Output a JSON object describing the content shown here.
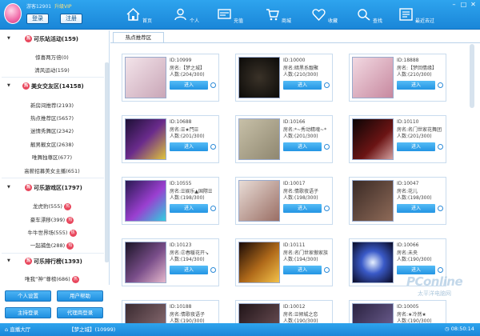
{
  "header": {
    "guest_text": "游客12901",
    "vip_text": "升级VIP",
    "login": "登录",
    "register": "注册",
    "nav": [
      {
        "label": "首页",
        "icon": "home-icon"
      },
      {
        "label": "个人",
        "icon": "user-icon"
      },
      {
        "label": "充值",
        "icon": "card-icon"
      },
      {
        "label": "商城",
        "icon": "cart-icon"
      },
      {
        "label": "收藏",
        "icon": "heart-icon"
      },
      {
        "label": "查找",
        "icon": "search-icon"
      },
      {
        "label": "最近去过",
        "icon": "history-icon"
      }
    ],
    "window_controls": {
      "min": "–",
      "max": "□",
      "close": "✕"
    }
  },
  "sidebar": {
    "categories": [
      {
        "title": "可乐站活动(159)",
        "items": [
          "惊喜两万倍(0)",
          "清风运动(159)"
        ]
      },
      {
        "title": "美女交友区(14158)",
        "items": [
          "新房间推荐(2193)",
          "热点推荐区(5657)",
          "迷情秀舞区(2342)",
          "靓男靓女区(2638)",
          "唯舞独尊区(677)",
          "高薪招募美女主播(651)"
        ]
      },
      {
        "title": "可乐游戏区(1797)",
        "items": [
          "龙虎豹(555)",
          "豪车漂移(399)",
          "牛牛世界场(555)",
          "一起捕鱼(288)"
        ]
      },
      {
        "title": "可乐排行榜(1393)",
        "items": [
          "唯我“神”尊榜(686)"
        ]
      }
    ],
    "hot_badge": "热",
    "cat_badge": "热",
    "buttons": [
      "个人设置",
      "用户帮助",
      "主持登录",
      "代理商登录"
    ]
  },
  "main": {
    "tab": "热点推荐区",
    "enter_label": "进入",
    "cards": [
      {
        "id": "ID:10999",
        "name": "房名:【梦之城】",
        "count": "人数:(204/300)"
      },
      {
        "id": "ID:10000",
        "name": "房名:暗黑系靓聚",
        "count": "人数:(210/300)"
      },
      {
        "id": "ID:18888",
        "name": "房名:【梦回情缘】",
        "count": "人数:(210/300)"
      },
      {
        "id": "ID:10688",
        "name": "房名:☰★門☰",
        "count": "人数:(201/300)"
      },
      {
        "id": "ID:10166",
        "name": "房名:*~秀动精魂~*",
        "count": "人数:(201/300)"
      },
      {
        "id": "ID:10110",
        "name": "房名:名门世家花舞团",
        "count": "人数:(201/300)"
      },
      {
        "id": "ID:10555",
        "name": "房名:☰娱乐▲国際☰",
        "count": "人数:(198/300)"
      },
      {
        "id": "ID:10017",
        "name": "房名:情歌夜语子",
        "count": "人数:(198/300)"
      },
      {
        "id": "ID:10047",
        "name": "房名:花儿",
        "count": "人数:(198/300)"
      },
      {
        "id": "ID:10123",
        "name": "房名:㊣春暖花开↘",
        "count": "人数:(194/300)"
      },
      {
        "id": "ID:10111",
        "name": "房名:名门世家傲家族",
        "count": "人数:(194/300)"
      },
      {
        "id": "ID:10066",
        "name": "房名:未央",
        "count": "人数:(190/300)"
      },
      {
        "id": "ID:10188",
        "name": "房名:情歌夜语子",
        "count": "人数:(190/300)"
      },
      {
        "id": "ID:10012",
        "name": "房名:☰倾城之恋",
        "count": "人数:(190/300)"
      },
      {
        "id": "ID:10005",
        "name": "房名:★冷然★",
        "count": "人数:(190/300)"
      }
    ]
  },
  "watermark": {
    "brand": "PConline",
    "sub": "太平洋电脑网"
  },
  "status": {
    "lobby": "直播大厅",
    "room": "【梦之城】(10999)",
    "time": "08:50:14"
  }
}
